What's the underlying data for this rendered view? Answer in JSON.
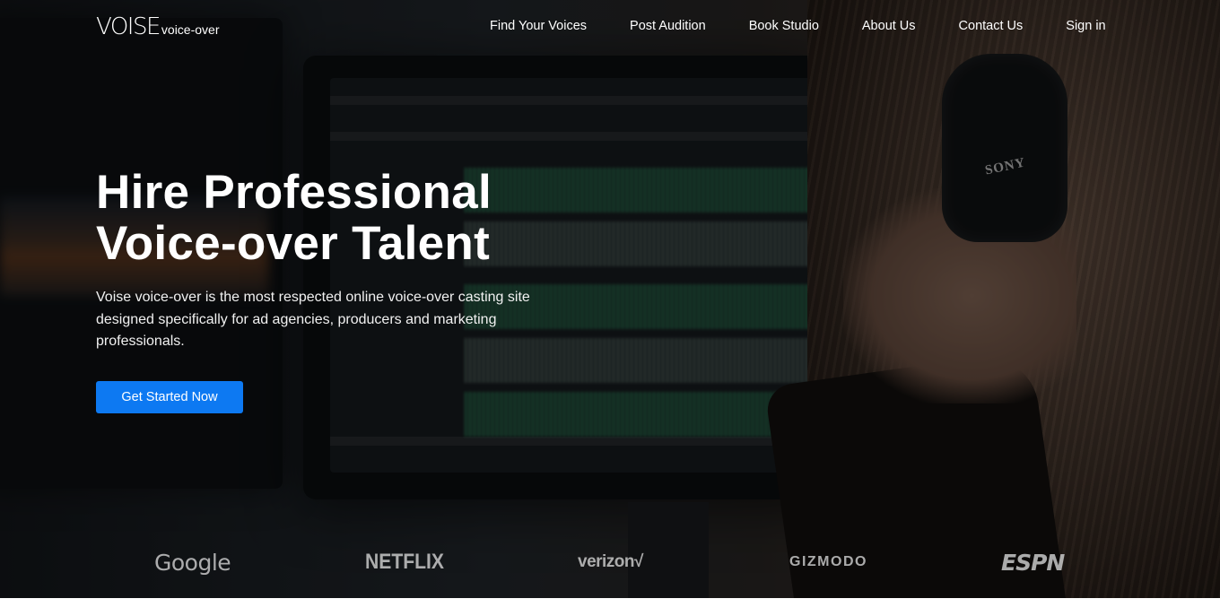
{
  "brand": {
    "name": "VOISE",
    "tagline": "voice-over"
  },
  "nav": {
    "items": [
      {
        "label": "Find Your Voices"
      },
      {
        "label": "Post Audition"
      },
      {
        "label": "Book Studio"
      },
      {
        "label": "About Us"
      },
      {
        "label": "Contact Us"
      },
      {
        "label": "Sign in"
      }
    ]
  },
  "hero": {
    "headline_line1": "Hire Professional",
    "headline_line2": "Voice-over Talent",
    "description": "Voise voice-over is the most respected online voice-over casting site designed specifically for ad agencies, producers and marketing professionals.",
    "cta_label": "Get Started Now",
    "cta_color": "#0d79f2",
    "headphone_brand": "SONY"
  },
  "clients": {
    "logos": [
      "Google",
      "NETFLIX",
      "verizon√",
      "GIZMODO",
      "ESPN"
    ]
  }
}
